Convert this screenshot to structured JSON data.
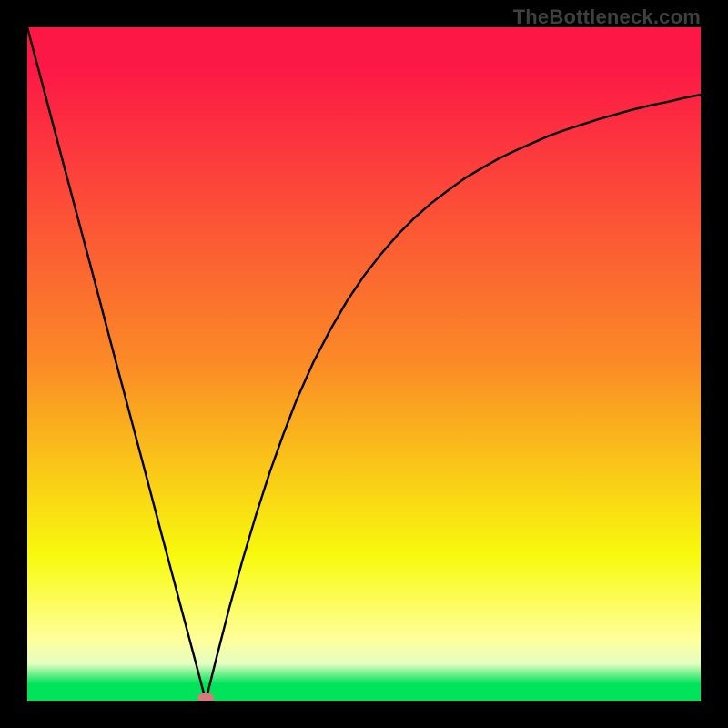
{
  "watermark": "TheBottleneck.com",
  "colors": {
    "frame": "#000000",
    "red": "#fc1745",
    "orange": "#fb8b26",
    "yellow": "#f8fa0d",
    "paleYellow": "#feff9b",
    "green": "#00e35b",
    "curve": "#000000",
    "marker": "#d77a7c"
  },
  "chart_data": {
    "type": "line",
    "title": "",
    "xlabel": "",
    "ylabel": "",
    "xlim": [
      0,
      1
    ],
    "ylim": [
      0,
      1
    ],
    "x_min_vertex": 0.265,
    "series": [
      {
        "name": "bottleneck-curve",
        "x": [
          0.0,
          0.025,
          0.05,
          0.075,
          0.1,
          0.125,
          0.15,
          0.175,
          0.2,
          0.225,
          0.25,
          0.265,
          0.28,
          0.3,
          0.32,
          0.34,
          0.36,
          0.38,
          0.4,
          0.425,
          0.45,
          0.475,
          0.5,
          0.525,
          0.55,
          0.575,
          0.6,
          0.625,
          0.65,
          0.675,
          0.7,
          0.725,
          0.75,
          0.775,
          0.8,
          0.825,
          0.85,
          0.875,
          0.9,
          0.925,
          0.95,
          0.975,
          1.0
        ],
        "y": [
          1.0,
          0.906,
          0.811,
          0.717,
          0.623,
          0.528,
          0.434,
          0.34,
          0.245,
          0.151,
          0.057,
          0.0,
          0.06,
          0.138,
          0.21,
          0.277,
          0.339,
          0.395,
          0.447,
          0.503,
          0.551,
          0.594,
          0.631,
          0.663,
          0.692,
          0.717,
          0.739,
          0.758,
          0.776,
          0.791,
          0.805,
          0.817,
          0.828,
          0.839,
          0.848,
          0.856,
          0.864,
          0.871,
          0.878,
          0.884,
          0.889,
          0.895,
          0.9
        ]
      }
    ],
    "marker": {
      "x": 0.265,
      "y": 0.0
    },
    "gradient_stops": [
      {
        "offset": 0.0,
        "color": "#fc1745"
      },
      {
        "offset": 0.06,
        "color": "#fc1846"
      },
      {
        "offset": 0.5,
        "color": "#fb8b26"
      },
      {
        "offset": 0.785,
        "color": "#f8fa0d"
      },
      {
        "offset": 0.91,
        "color": "#feff9b"
      },
      {
        "offset": 0.945,
        "color": "#e4fec2"
      },
      {
        "offset": 0.975,
        "color": "#00e35b"
      },
      {
        "offset": 1.0,
        "color": "#00e35b"
      }
    ]
  }
}
